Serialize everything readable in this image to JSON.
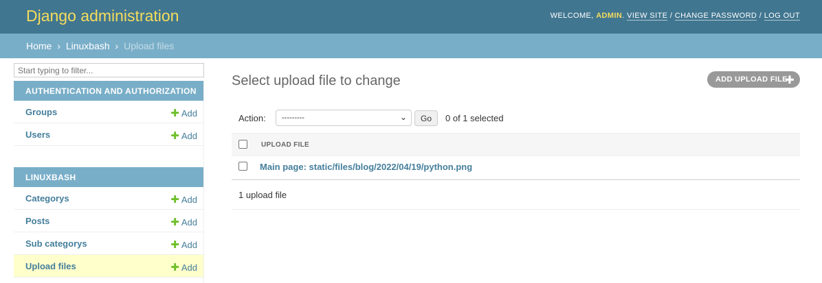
{
  "header": {
    "brand": "Django administration",
    "welcome": "WELCOME,",
    "username": "ADMIN",
    "view_site": "VIEW SITE",
    "change_password": "CHANGE PASSWORD",
    "log_out": "LOG OUT",
    "sep": "/"
  },
  "breadcrumbs": {
    "home": "Home",
    "app": "Linuxbash",
    "current": "Upload files",
    "sep": "›"
  },
  "sidebar": {
    "filter_placeholder": "Start typing to filter...",
    "add_label": "Add",
    "modules": [
      {
        "caption": "AUTHENTICATION AND AUTHORIZATION",
        "models": [
          {
            "name": "Groups"
          },
          {
            "name": "Users"
          }
        ]
      },
      {
        "caption": "LINUXBASH",
        "models": [
          {
            "name": "Categorys"
          },
          {
            "name": "Posts"
          },
          {
            "name": "Sub categorys"
          },
          {
            "name": "Upload files",
            "current": true
          }
        ]
      }
    ]
  },
  "content": {
    "title": "Select upload file to change",
    "add_button": "ADD UPLOAD FILE",
    "actions": {
      "label": "Action:",
      "selected_option": "---------",
      "go": "Go",
      "selected_count": "0 of 1 selected"
    },
    "table": {
      "column": "UPLOAD FILE",
      "rows": [
        {
          "label": "Main page: static/files/blog/2022/04/19/python.png"
        }
      ]
    },
    "paginator": "1 upload file"
  },
  "colors": {
    "header_bg": "#417690",
    "brand": "#f5dd5d",
    "breadcrumbs_bg": "#79aec8",
    "link": "#447e9b",
    "add_icon": "#70bf2b",
    "current_row": "#ffffcc"
  }
}
